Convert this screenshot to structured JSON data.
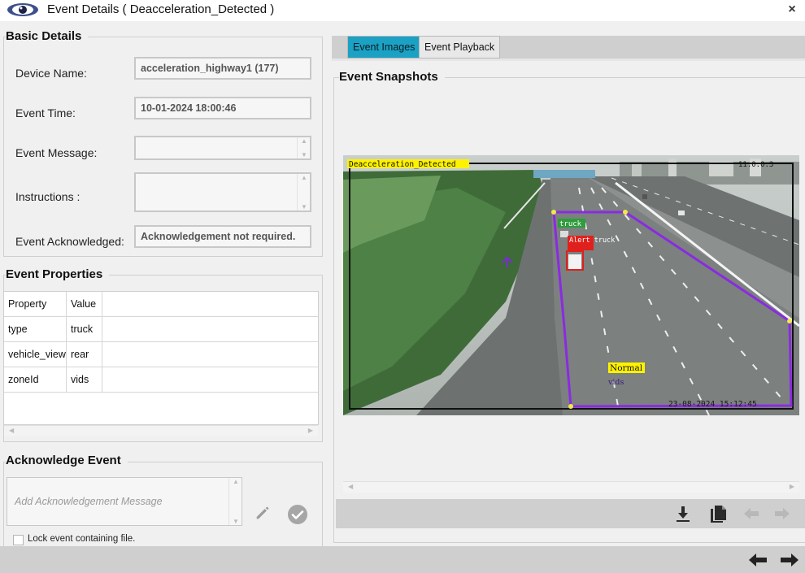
{
  "window": {
    "title": "Event Details ( Deacceleration_Detected )",
    "close_symbol": "×"
  },
  "basic_details": {
    "heading": "Basic Details",
    "device_name_label": "Device Name:",
    "device_name_value": "acceleration_highway1 (177)",
    "event_time_label": "Event Time:",
    "event_time_value": "10-01-2024 18:00:46",
    "event_message_label": "Event Message:",
    "event_message_value": "",
    "instructions_label": "Instructions :",
    "instructions_value": "",
    "event_ack_label": "Event Acknowledged:",
    "event_ack_value": "Acknowledgement not required."
  },
  "event_properties": {
    "heading": "Event Properties",
    "columns": [
      "Property",
      "Value"
    ],
    "rows": [
      {
        "property": "type",
        "value": "truck"
      },
      {
        "property": "vehicle_view",
        "value": "rear"
      },
      {
        "property": "zoneId",
        "value": "vids"
      }
    ]
  },
  "acknowledge_event": {
    "heading": "Acknowledge Event",
    "placeholder": "Add Acknowledgement Message",
    "lock_label": "Lock event containing file.",
    "lock_checked": false
  },
  "tabs": [
    {
      "label": "Event Images",
      "active": true
    },
    {
      "label": "Event Playback",
      "active": false
    }
  ],
  "snapshots": {
    "heading": "Event Snapshots",
    "overlay_event_label": "Deacceleration_Detected",
    "overlay_timestamp": "23-08-2024 15:12:45",
    "overlay_top_right": "11.0.0.3",
    "detections": [
      {
        "label": "truck",
        "color": "#2e9d3c"
      },
      {
        "label": "Alert truck",
        "color": "#e0201c"
      }
    ],
    "zone_status": "Normal",
    "zone_name": "vids",
    "zone_color": "#8a2be2"
  },
  "toolbar_icons": [
    "download-icon",
    "copy-icon",
    "prev-image-icon",
    "next-image-icon"
  ],
  "navigation_icons": [
    "prev-event-icon",
    "next-event-icon"
  ],
  "colors": {
    "accent_tab": "#1ba1c4",
    "panel": "#f0f0f0",
    "bar": "#cfcfcf"
  }
}
